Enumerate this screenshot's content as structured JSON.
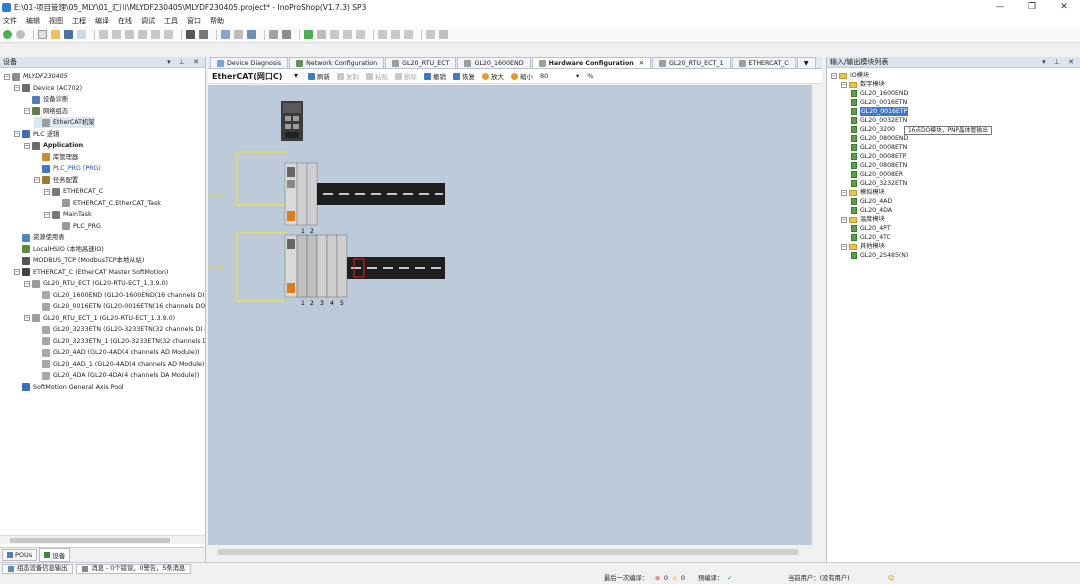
{
  "window": {
    "title": "E:\\01-项目管理\\05_MLY\\01_汇川\\MLYDF230405\\MLYDF230405.project* - InoProShop(V1.7.3) SP3",
    "minimize": "—",
    "maximize": "❐",
    "close": "✕"
  },
  "menu": [
    "文件",
    "编辑",
    "视图",
    "工程",
    "编译",
    "在线",
    "调试",
    "工具",
    "窗口",
    "帮助"
  ],
  "colors": {
    "canvas": "#bccad9",
    "accent": "#3e78c9",
    "connector": "#f0e23a",
    "rail": "#1e1e1e",
    "plc_body": "#3a3a3a"
  },
  "left_panel": {
    "title": "设备",
    "pin": "▾ ⊥ ✕",
    "tree": [
      {
        "label": "MLYDF230405",
        "level": 0,
        "exp": "−",
        "icon": "project-icon",
        "italic": true
      },
      {
        "label": "Device (AC702)",
        "level": 1,
        "exp": "−",
        "icon": "device-icon"
      },
      {
        "label": "设备诊断",
        "level": 2,
        "exp": "",
        "icon": "diagnosis-icon"
      },
      {
        "label": "网络组态",
        "level": 2,
        "exp": "−",
        "icon": "network-icon"
      },
      {
        "label": "EtherCAT机架",
        "level": 3,
        "exp": "",
        "icon": "rack-icon",
        "selected": true
      },
      {
        "label": "PLC 逻辑",
        "level": 1,
        "exp": "−",
        "icon": "plc-logic-icon"
      },
      {
        "label": "Application",
        "level": 2,
        "exp": "−",
        "icon": "application-icon",
        "bold": true
      },
      {
        "label": "库管理器",
        "level": 3,
        "exp": "",
        "icon": "library-icon"
      },
      {
        "label": "PLC_PRG (PRG)",
        "level": 3,
        "exp": "",
        "icon": "program-icon",
        "blue": true
      },
      {
        "label": "任务配置",
        "level": 3,
        "exp": "−",
        "icon": "task-config-icon"
      },
      {
        "label": "ETHERCAT_C",
        "level": 4,
        "exp": "−",
        "icon": "task-icon"
      },
      {
        "label": "ETHERCAT_C.EtherCAT_Task",
        "level": 5,
        "exp": "",
        "icon": "task-call-icon"
      },
      {
        "label": "MainTask",
        "level": 4,
        "exp": "−",
        "icon": "task-icon"
      },
      {
        "label": "PLC_PRG",
        "level": 5,
        "exp": "",
        "icon": "task-call-icon"
      },
      {
        "label": "资源使用表",
        "level": 1,
        "exp": "",
        "icon": "resource-icon"
      },
      {
        "label": "LocalHSIO (本地高速IO)",
        "level": 1,
        "exp": "",
        "icon": "io-icon"
      },
      {
        "label": "MODBUS_TCP (ModbusTCP本地从站)",
        "level": 1,
        "exp": "",
        "icon": "modbus-icon"
      },
      {
        "label": "ETHERCAT_C (EtherCAT Master SoftMotion)",
        "level": 1,
        "exp": "−",
        "icon": "ethercat-icon"
      },
      {
        "label": "GL20_RTU_ECT (GL20-RTU-ECT_1.3.9.0)",
        "level": 2,
        "exp": "−",
        "icon": "coupler-icon"
      },
      {
        "label": "GL20_1600END (GL20-1600END(16 channels DI mo",
        "level": 3,
        "exp": "",
        "icon": "module-icon"
      },
      {
        "label": "GL20_0016ETN (GL20-0016ETN(16 channels DO mo",
        "level": 3,
        "exp": "",
        "icon": "module-icon"
      },
      {
        "label": "GL20_RTU_ECT_1 (GL20-RTU-ECT_1.3.9.0)",
        "level": 2,
        "exp": "−",
        "icon": "coupler-icon"
      },
      {
        "label": "GL20_3233ETN (GL20-3233ETN(32 channels DI and",
        "level": 3,
        "exp": "",
        "icon": "module-icon"
      },
      {
        "label": "GL20_3233ETN_1 (GL20-3233ETN(32 channels DI a",
        "level": 3,
        "exp": "",
        "icon": "module-icon"
      },
      {
        "label": "GL20_4AD (GL20-4AD(4 channels AD Module))",
        "level": 3,
        "exp": "",
        "icon": "module-icon"
      },
      {
        "label": "GL20_4AD_1 (GL20-4AD(4 channels AD Module))",
        "level": 3,
        "exp": "",
        "icon": "module-icon"
      },
      {
        "label": "GL20_4DA (GL20-4DA(4 channels DA Module))",
        "level": 3,
        "exp": "",
        "icon": "module-icon"
      },
      {
        "label": "SoftMotion General Axis Pool",
        "level": 1,
        "exp": "",
        "icon": "axis-pool-icon"
      }
    ],
    "bottom_tabs": [
      "POUs",
      "设备"
    ]
  },
  "center": {
    "tabs": [
      {
        "label": "Device Diagnosis",
        "active": false
      },
      {
        "label": "Network Configuration",
        "active": false
      },
      {
        "label": "GL20_RTU_ECT",
        "active": false
      },
      {
        "label": "GL20_1600END",
        "active": false
      },
      {
        "label": "Hardware Configuration",
        "active": true
      },
      {
        "label": "GL20_RTU_ECT_1",
        "active": false
      },
      {
        "label": "ETHERCAT_C",
        "active": false
      }
    ],
    "tab_overflow": "▼",
    "editor_toolbar": {
      "combo": "EtherCAT(网口C)",
      "combo_arrow": "▾",
      "refresh": "刷新",
      "copy": "复制",
      "paste": "粘贴",
      "delete": "删除",
      "undo": "撤销",
      "redo": "恢复",
      "zoom_in": "放大",
      "zoom_out": "缩小",
      "zoom_value": "80",
      "zoom_unit": "%"
    },
    "canvas": {
      "row1_label": "No.1",
      "row2_label": "No.2",
      "row1_slots": [
        "1",
        "2"
      ],
      "row2_slots": [
        "1",
        "2",
        "3",
        "4",
        "5"
      ]
    }
  },
  "right_panel": {
    "title": "输入/输出模块列表",
    "pin": "▾ ⊥ ✕",
    "tree": [
      {
        "label": "IO模块",
        "level": 0,
        "type": "folder"
      },
      {
        "label": "数字模块",
        "level": 1,
        "type": "folder"
      },
      {
        "label": "GL20_1600END",
        "level": 2,
        "type": "mod"
      },
      {
        "label": "GL20_0016ETN",
        "level": 2,
        "type": "mod"
      },
      {
        "label": "GL20_0016ETP",
        "level": 2,
        "type": "mod",
        "selected": true
      },
      {
        "label": "GL20_0032ETN",
        "level": 2,
        "type": "mod"
      },
      {
        "label": "GL20_3200",
        "level": 2,
        "type": "mod"
      },
      {
        "label": "GL20_0800END",
        "level": 2,
        "type": "mod"
      },
      {
        "label": "GL20_0008ETN",
        "level": 2,
        "type": "mod"
      },
      {
        "label": "GL20_0008ETP",
        "level": 2,
        "type": "mod"
      },
      {
        "label": "GL20_0808ETN",
        "level": 2,
        "type": "mod"
      },
      {
        "label": "GL20_0008ER",
        "level": 2,
        "type": "mod"
      },
      {
        "label": "GL20_3232ETN",
        "level": 2,
        "type": "mod"
      },
      {
        "label": "模拟模块",
        "level": 1,
        "type": "folder"
      },
      {
        "label": "GL20_4AD",
        "level": 2,
        "type": "mod"
      },
      {
        "label": "GL20_4DA",
        "level": 2,
        "type": "mod"
      },
      {
        "label": "温度模块",
        "level": 1,
        "type": "folder"
      },
      {
        "label": "GL20_4PT",
        "level": 2,
        "type": "mod"
      },
      {
        "label": "GL20_4TC",
        "level": 2,
        "type": "mod"
      },
      {
        "label": "其他模块",
        "level": 1,
        "type": "folder"
      },
      {
        "label": "GL20_2S485(N)",
        "level": 2,
        "type": "mod"
      }
    ],
    "tooltip": "16点DO模块，PNP晶体管输出"
  },
  "messages": {
    "tab1": "组态设备信息输出",
    "tab2": "消息 - 0个错误，0警告，5条消息"
  },
  "status": {
    "last_compile": "最后一次编译：",
    "errors": "0",
    "warnings": "0",
    "precompile": "预编译：",
    "precompile_ok": "✓",
    "current_user": "当前用户：(没有用户)"
  }
}
